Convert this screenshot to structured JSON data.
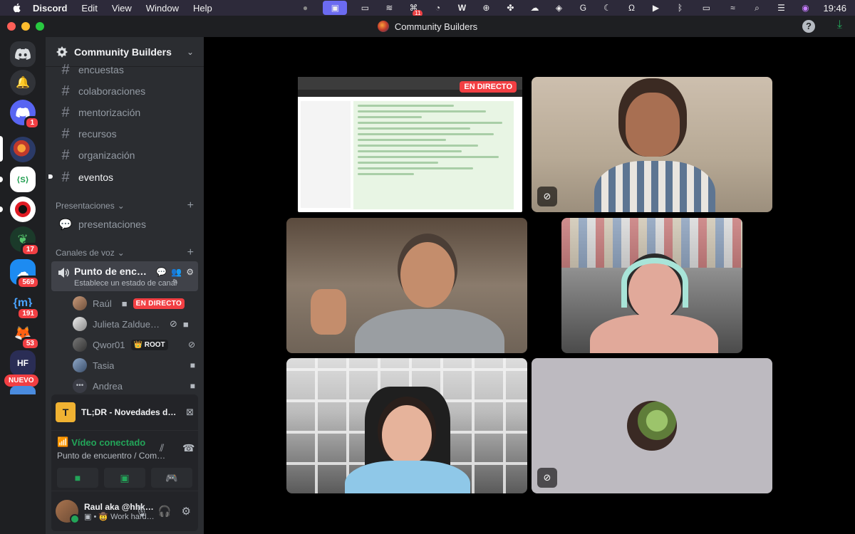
{
  "menubar": {
    "app": "Discord",
    "items": [
      "Edit",
      "View",
      "Window",
      "Help"
    ],
    "notif_count": "11",
    "clock": "19:46"
  },
  "window": {
    "title": "Community Builders"
  },
  "rail": {
    "badges": {
      "discord": "1",
      "leaf": "17",
      "blue": "569",
      "ml": "191",
      "fox": "53"
    },
    "hf": "HF",
    "new_label": "NUEVO"
  },
  "sidebar": {
    "guild_name": "Community Builders",
    "channels": [
      {
        "name": "encuestas"
      },
      {
        "name": "colaboraciones"
      },
      {
        "name": "mentorización"
      },
      {
        "name": "recursos"
      },
      {
        "name": "organización"
      },
      {
        "name": "eventos"
      }
    ],
    "presentaciones_category": "Presentaciones",
    "presentaciones_channel": "presentaciones",
    "voice_category": "Canales de voz",
    "voice_channel": {
      "name": "Punto de encuentro",
      "status": "Establece un estado de canal"
    },
    "voice_users": [
      {
        "name": "Raúl",
        "tag": "EN DIRECTO"
      },
      {
        "name": "Julieta Zalduendo"
      },
      {
        "name": "Qwor01",
        "tag": "ROOT"
      },
      {
        "name": "Tasia"
      },
      {
        "name": "Andrea"
      }
    ]
  },
  "activity": {
    "icon": "T",
    "text": "TL;DR - Novedades de la Comunidad"
  },
  "voice_panel": {
    "status": "Vídeo conectado",
    "location": "Punto de encuentro / Community Builders"
  },
  "user": {
    "name": "Raul aka @hhkaos",
    "status": "Work hard!, party hard!"
  },
  "stage": {
    "live_label": "EN DIRECTO"
  }
}
